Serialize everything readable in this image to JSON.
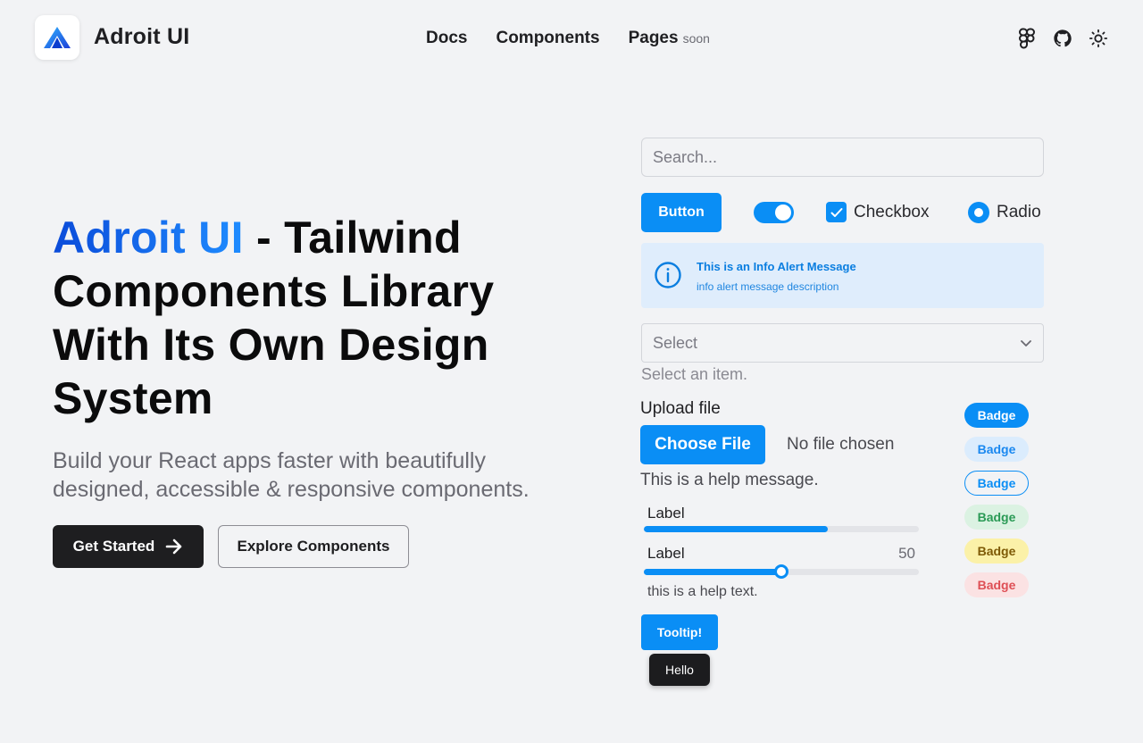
{
  "header": {
    "brand": "Adroit UI",
    "nav": [
      {
        "label": "Docs"
      },
      {
        "label": "Components"
      },
      {
        "label": "Pages",
        "tag": "soon"
      }
    ],
    "icons": [
      "figma-icon",
      "github-icon",
      "sun-icon"
    ]
  },
  "hero": {
    "title_highlight": "Adroit UI",
    "title_rest": " - Tailwind Components Library With Its Own Design System",
    "subtitle": "Build your React apps faster with beautifully designed, accessible & responsive components.",
    "primary_button": "Get Started",
    "secondary_button": "Explore Components"
  },
  "showcase": {
    "search_placeholder": "Search...",
    "button_label": "Button",
    "toggle_on": true,
    "checkbox_label": "Checkbox",
    "checkbox_checked": true,
    "radio_label": "Radio",
    "radio_selected": true,
    "alert": {
      "title": "This is an Info Alert Message",
      "description": "info alert message description"
    },
    "select": {
      "value": "Select",
      "help": "Select an item."
    },
    "upload": {
      "label": "Upload file",
      "button": "Choose File",
      "status": "No file chosen",
      "help": "This is a help message."
    },
    "progress": {
      "label": "Label",
      "value_fraction": 0.67
    },
    "slider": {
      "label": "Label",
      "value": "50",
      "fraction": 0.5,
      "help": "this is a help text."
    },
    "tooltip": {
      "button": "Tooltip!",
      "text": "Hello"
    },
    "badges": [
      {
        "label": "Badge",
        "variant": "solid"
      },
      {
        "label": "Badge",
        "variant": "soft"
      },
      {
        "label": "Badge",
        "variant": "outline"
      },
      {
        "label": "Badge",
        "variant": "green"
      },
      {
        "label": "Badge",
        "variant": "yellow"
      },
      {
        "label": "Badge",
        "variant": "red"
      }
    ]
  },
  "colors": {
    "primary": "#0a8ef5",
    "dark": "#1e1e20",
    "background": "#f2f3f5",
    "gradient_start": "#0b4bd9",
    "gradient_end": "#1f8cff"
  }
}
